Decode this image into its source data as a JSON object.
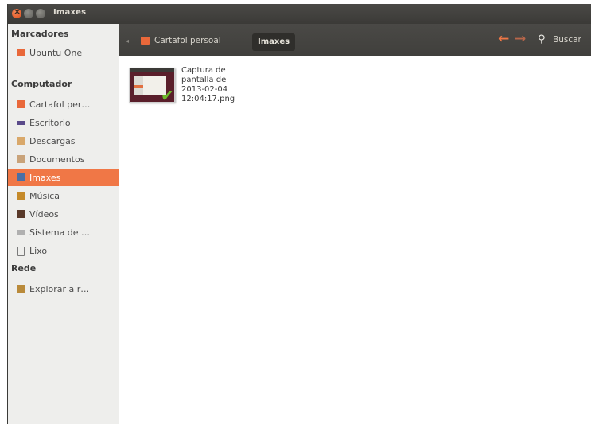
{
  "window": {
    "title": "Imaxes"
  },
  "sidebar": {
    "sections": [
      {
        "label": "Marcadores",
        "items": [
          {
            "label": "Ubuntu One",
            "icon": "ubuntu-one-icon",
            "color": "#e9683a"
          }
        ]
      },
      {
        "label": "Computador",
        "items": [
          {
            "label": "Cartafol per…",
            "icon": "home-folder-icon",
            "color": "#e9683a"
          },
          {
            "label": "Escritorio",
            "icon": "desktop-icon",
            "color": "#5a4a8a"
          },
          {
            "label": "Descargas",
            "icon": "downloads-folder-icon",
            "color": "#d9a86a"
          },
          {
            "label": "Documentos",
            "icon": "documents-folder-icon",
            "color": "#c9a37a"
          },
          {
            "label": "Imaxes",
            "icon": "pictures-folder-icon",
            "color": "#4a6fa5",
            "active": true
          },
          {
            "label": "Música",
            "icon": "music-folder-icon",
            "color": "#c58a2a"
          },
          {
            "label": "Vídeos",
            "icon": "videos-folder-icon",
            "color": "#5a3a2a"
          },
          {
            "label": "Sistema de …",
            "icon": "filesystem-icon",
            "color": "#9a9a9a"
          },
          {
            "label": "Lixo",
            "icon": "trash-icon",
            "color": "#7a7a7a"
          }
        ]
      },
      {
        "label": "Rede",
        "items": [
          {
            "label": "Explorar a r…",
            "icon": "network-icon",
            "color": "#b98a3a"
          }
        ]
      }
    ]
  },
  "toolbar": {
    "breadcrumb": [
      "Cartafol persoal",
      "Imaxes"
    ],
    "search_label": "Buscar"
  },
  "files": [
    {
      "name_lines": [
        "Captura de",
        "pantalla de",
        "2013-02-04",
        "12:04:17.png"
      ]
    }
  ],
  "colors": {
    "accent": "#f07746",
    "sidebar_bg": "#eeeeec",
    "titlebar_bg": "#3f3e3b"
  }
}
